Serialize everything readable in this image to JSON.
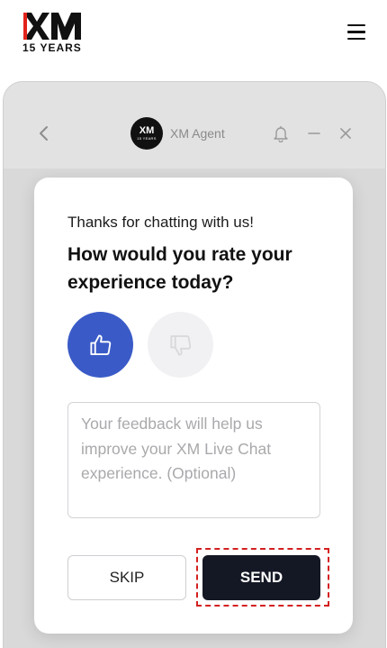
{
  "site": {
    "logo_text": "XM",
    "logo_years": "15 YEARS",
    "logo_accent": "#e2231a"
  },
  "chat": {
    "agent_name": "XM Agent",
    "avatar_text": "XM",
    "avatar_years": "15 YEARS",
    "header_icons": [
      "chevron-left-icon",
      "bell-icon",
      "minimize-icon",
      "close-icon"
    ]
  },
  "rating": {
    "intro": "Thanks for chatting with us!",
    "question": "How would you rate your experience today?",
    "thumb_up_color": "#3a5bc7",
    "thumb_down_color": "#f1f1f3",
    "feedback_placeholder": "Your feedback will help us improve your XM Live Chat experience. (Optional)",
    "skip_label": "SKIP",
    "send_label": "SEND"
  }
}
